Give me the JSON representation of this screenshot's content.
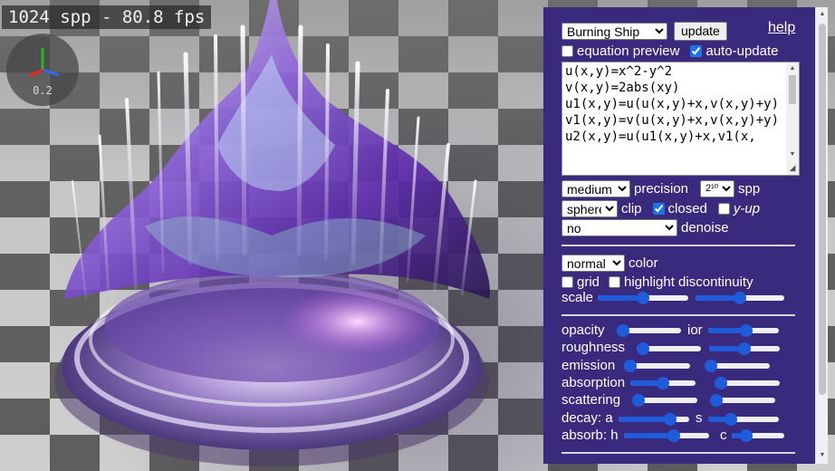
{
  "stats": {
    "text": "1024 spp - 80.8 fps"
  },
  "gizmo": {
    "label": "0.2"
  },
  "panel": {
    "preset": {
      "selected": "Burning Ship"
    },
    "update_label": "update",
    "help_label": "help",
    "equation_preview": {
      "label": "equation preview",
      "checked": false
    },
    "auto_update": {
      "label": "auto-update",
      "checked": true
    },
    "equation_text": "u(x,y)=x^2-y^2\nv(x,y)=2abs(xy)\nu1(x,y)=u(u(x,y)+x,v(x,y)+y)\nv1(x,y)=v(u(x,y)+x,v(x,y)+y)\nu2(x,y)=u(u1(x,y)+x,v1(x,",
    "precision": {
      "selected": "medium",
      "label": "precision"
    },
    "spp": {
      "selected": "2¹⁰",
      "label": "spp"
    },
    "clip": {
      "selected": "sphere",
      "label": "clip"
    },
    "closed": {
      "label": "closed",
      "checked": true
    },
    "y_up": {
      "label": "y-up",
      "checked": false
    },
    "denoise": {
      "selected": "no",
      "label": "denoise"
    },
    "color": {
      "selected": "normal",
      "label": "color"
    },
    "grid": {
      "label": "grid",
      "checked": false
    },
    "highlight": {
      "label": "highlight discontinuity",
      "checked": false
    },
    "scale": {
      "label": "scale",
      "values": [
        0.5,
        0.5
      ]
    },
    "opacity": {
      "label": "opacity",
      "value": 0.0
    },
    "ior": {
      "label": "ior",
      "value": 0.55
    },
    "roughness": {
      "label": "roughness",
      "value": 0.0
    },
    "roughness2": {
      "value": 0.5
    },
    "emission": {
      "label": "emission",
      "value": 0.0
    },
    "emission2": {
      "value": 0.0
    },
    "absorption": {
      "label": "absorption",
      "value": 0.5
    },
    "absorption2": {
      "value": 0.0
    },
    "scattering": {
      "label": "scattering",
      "value": 0.0
    },
    "scattering2": {
      "value": 0.0
    },
    "decay_a": {
      "label": "decay: a",
      "value": 0.78
    },
    "decay_s": {
      "label": "s",
      "value": 0.28
    },
    "absorb_h": {
      "label": "absorb: h",
      "value": 0.6
    },
    "absorb_c": {
      "label": "c",
      "value": 0.2
    }
  },
  "colors": {
    "panel_bg": "#3a2a7e",
    "slider_accent": "#1f5cdb"
  }
}
